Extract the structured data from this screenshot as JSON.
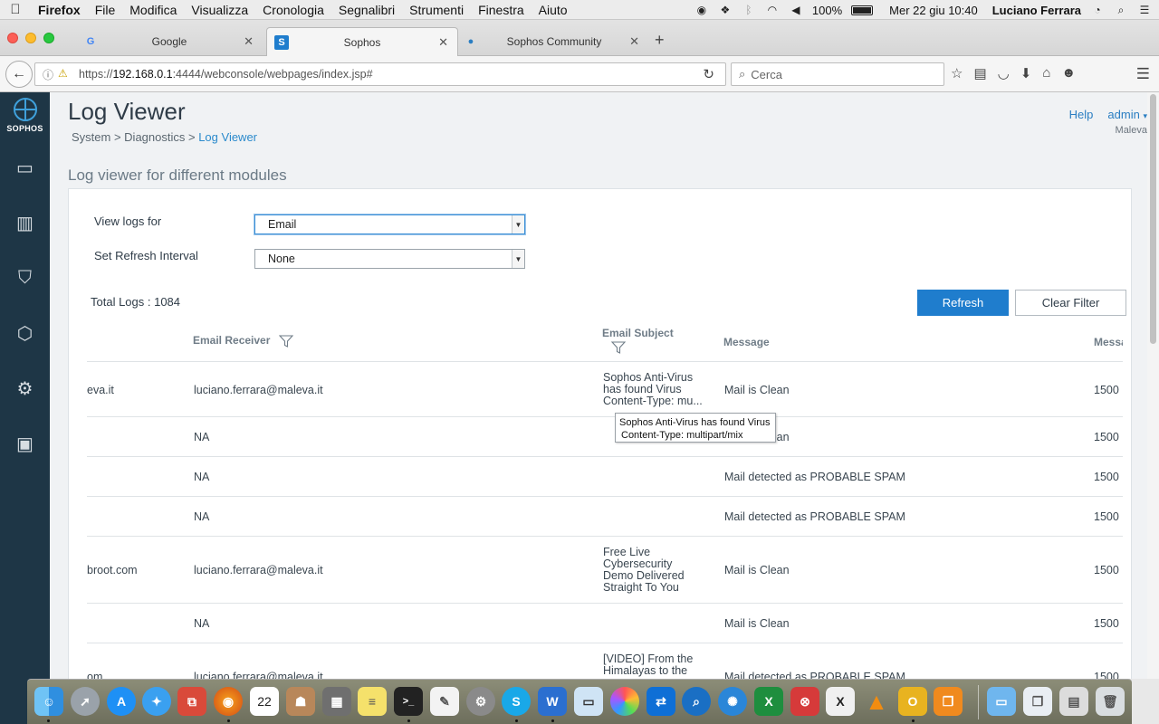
{
  "menubar": {
    "app": "Firefox",
    "items": [
      "File",
      "Modifica",
      "Visualizza",
      "Cronologia",
      "Segnalibri",
      "Strumenti",
      "Finestra",
      "Aiuto"
    ],
    "battery": "100%",
    "datetime": "Mer 22 giu  10:40",
    "user": "Luciano Ferrara"
  },
  "tabs": [
    {
      "title": "Google",
      "favicon": "G",
      "favicon_color": "#4285f4"
    },
    {
      "title": "Sophos",
      "favicon": "S",
      "favicon_color": "#1f7dcd"
    },
    {
      "title": "Sophos Community",
      "favicon": "●",
      "favicon_color": "#2a7ec2"
    }
  ],
  "navbar": {
    "url_prefix": "https://",
    "url_host": "192.168.0.1",
    "url_rest": ":4444/webconsole/webpages/index.jsp#",
    "search_placeholder": "Cerca"
  },
  "sidebar": {
    "brand": "SOPHOS",
    "items": [
      "monitor-icon",
      "reports-icon",
      "protect-icon",
      "configure-icon",
      "system-icon",
      "package-icon"
    ]
  },
  "header": {
    "title": "Log Viewer",
    "breadcrumb": [
      "System",
      "Diagnostics",
      "Log Viewer"
    ],
    "help": "Help",
    "user": "admin",
    "org": "Maleva"
  },
  "section_title": "Log viewer for different modules",
  "form": {
    "view_logs_label": "View logs for",
    "view_logs_value": "Email",
    "refresh_label": "Set Refresh Interval",
    "refresh_value": "None"
  },
  "total_logs": "Total Logs : 1084",
  "buttons": {
    "refresh": "Refresh",
    "clear_filter": "Clear Filter"
  },
  "table": {
    "headers": {
      "receiver": "Email Receiver",
      "subject": "Email Subject",
      "message": "Message",
      "message_id": "Messa"
    },
    "rows": [
      {
        "sender": "eva.it",
        "receiver": "luciano.ferrara@maleva.it",
        "subject": "Sophos Anti-Virus has found Virus Content-Type: mu...",
        "message": "Mail is Clean",
        "id": "1500"
      },
      {
        "sender": "",
        "receiver": "NA",
        "subject": "",
        "message": "Mail is Clean",
        "id": "1500"
      },
      {
        "sender": "",
        "receiver": "NA",
        "subject": "",
        "message": "Mail detected as PROBABLE SPAM",
        "id": "1500"
      },
      {
        "sender": "",
        "receiver": "NA",
        "subject": "",
        "message": "Mail detected as PROBABLE SPAM",
        "id": "1500"
      },
      {
        "sender": "broot.com",
        "receiver": "luciano.ferrara@maleva.it",
        "subject": "Free Live Cybersecurity Demo Delivered Straight To You",
        "message": "Mail is Clean",
        "id": "1500"
      },
      {
        "sender": "",
        "receiver": "NA",
        "subject": "",
        "message": "Mail is Clean",
        "id": "1500"
      },
      {
        "sender": "om",
        "receiver": "luciano.ferrara@maleva.it",
        "subject": "[VIDEO] From the Himalayas to the",
        "message": "Mail detected as PROBABLE SPAM",
        "id": "1500"
      }
    ]
  },
  "tooltip": {
    "line1": "Sophos Anti-Virus has found Virus",
    "line2": "Content-Type: multipart/mix"
  },
  "dock": {
    "calendar_day": "22",
    "apps": [
      "finder-icon",
      "launchpad-icon",
      "appstore-icon",
      "safari-icon",
      "network-icon",
      "firefox-icon",
      "calendar-icon",
      "contacts-icon",
      "calculator-icon",
      "notes-icon",
      "terminal-icon",
      "textedit-icon",
      "preferences-icon",
      "skype-icon",
      "word-icon",
      "preview-icon",
      "photos-icon",
      "teamviewer-icon",
      "search-icon",
      "network-share-icon",
      "excel-icon",
      "remote-desktop-icon",
      "xquartz-icon",
      "vlc-icon",
      "outlook-icon",
      "books-icon",
      "folder-icon",
      "documents-icon",
      "downloads-icon",
      "trash-icon"
    ]
  }
}
